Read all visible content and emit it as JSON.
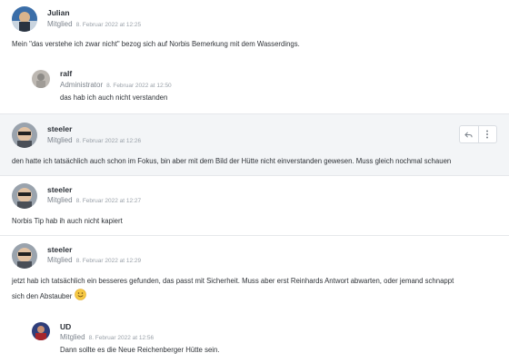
{
  "posts": [
    {
      "author": "Julian",
      "role": "Mitglied",
      "date": "8. Februar 2022 at 12:25",
      "text": "Mein \"das verstehe ich zwar nicht\" bezog sich auf Norbis Bemerkung mit dem Wasserdings."
    },
    {
      "author": "ralf",
      "role": "Administrator",
      "date": "8. Februar 2022 at 12:50",
      "text": "das hab ich auch nicht verstanden"
    },
    {
      "author": "steeler",
      "role": "Mitglied",
      "date": "8. Februar 2022 at 12:26",
      "text": "den hatte ich tatsächlich auch schon im Fokus, bin aber mit dem Bild der Hütte nicht einverstanden gewesen. Muss gleich nochmal schauen"
    },
    {
      "author": "steeler",
      "role": "Mitglied",
      "date": "8. Februar 2022 at 12:27",
      "text": "Norbis Tip hab ih auch nicht kapiert"
    },
    {
      "author": "steeler",
      "role": "Mitglied",
      "date": "8. Februar 2022 at 12:29",
      "text_line1": "jetzt hab ich tatsächlich ein besseres gefunden, das passt mit Sicherheit. Muss aber erst Reinhards Antwort abwarten, oder jemand schnappt",
      "text_line2": "sich den Abstauber"
    },
    {
      "author": "UD",
      "role": "Mitglied",
      "date": "8. Februar 2022 at 12:56",
      "text": "Dann sollte es die Neue Reichenberger Hütte sein."
    }
  ],
  "actions": {
    "reply_icon": "reply-icon",
    "more_icon": "more-vertical-icon"
  },
  "colors": {
    "highlight_bg": "#f3f5f7",
    "divider": "#e6e8eb",
    "meta_text": "#8a9099"
  }
}
